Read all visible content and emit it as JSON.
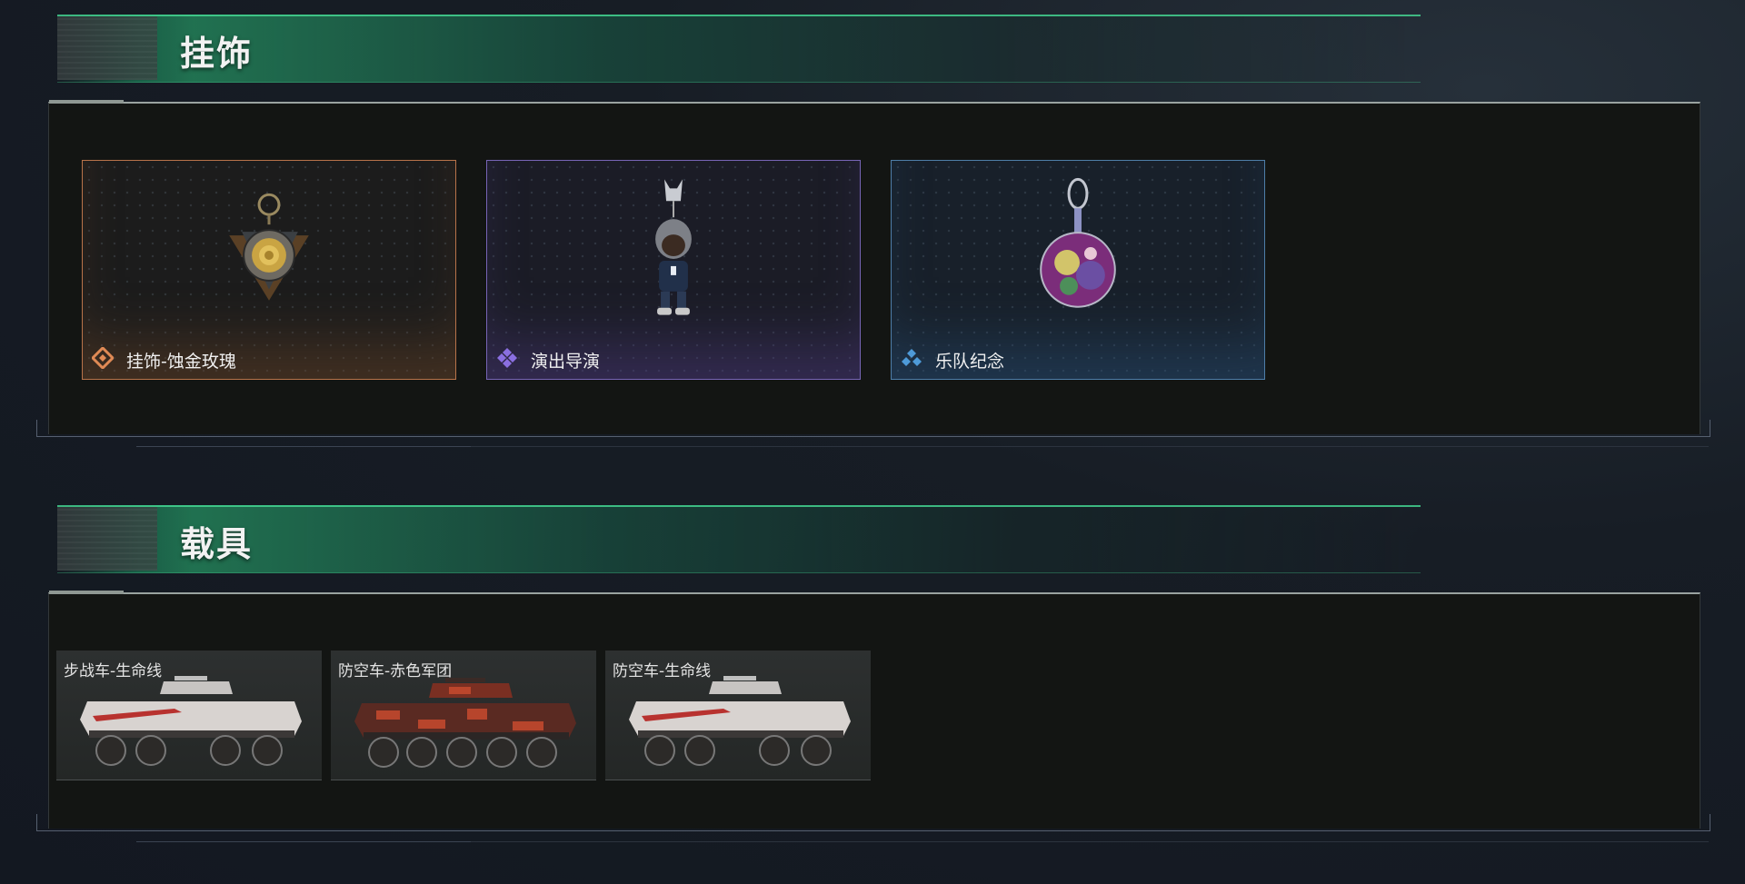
{
  "sections": {
    "charms": {
      "title": "挂饰",
      "items": [
        {
          "name": "挂饰-蚀金玫瑰",
          "rarity_color": "#e08a55",
          "icon": "rose-charm-icon"
        },
        {
          "name": "演出导演",
          "rarity_color": "#8a6fe0",
          "icon": "director-figure-charm-icon"
        },
        {
          "name": "乐队纪念",
          "rarity_color": "#4e9ad8",
          "icon": "band-badge-charm-icon"
        }
      ]
    },
    "vehicles": {
      "title": "载具",
      "items": [
        {
          "name": "步战车-生命线",
          "skin": "lifeline",
          "icon": "armored-vehicle-icon"
        },
        {
          "name": "防空车-赤色军团",
          "skin": "red-legion",
          "icon": "armored-vehicle-icon"
        },
        {
          "name": "防空车-生命线",
          "skin": "lifeline",
          "icon": "armored-vehicle-icon"
        }
      ]
    }
  },
  "colors": {
    "accent_green": "#2ec98a",
    "panel_bg": "#131513",
    "orange_rarity": "#e08a55",
    "purple_rarity": "#8a6fe0",
    "blue_rarity": "#4e9ad8"
  }
}
